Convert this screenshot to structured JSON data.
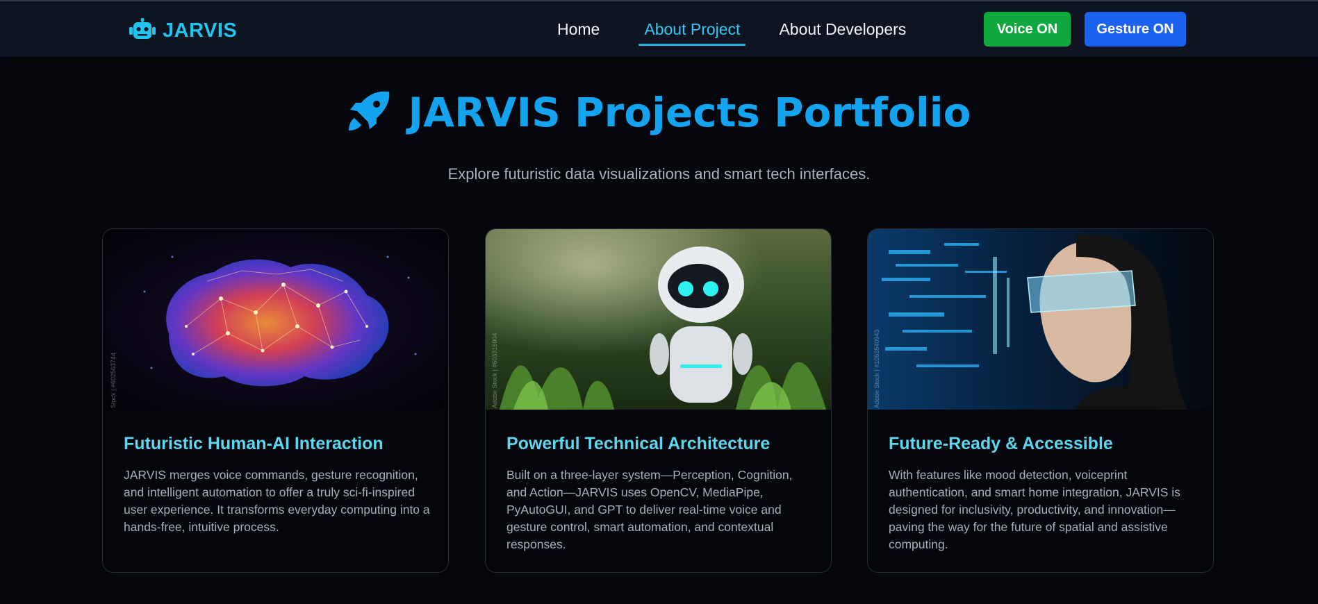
{
  "nav": {
    "brand": "JARVIS",
    "links": [
      "Home",
      "About Project",
      "About Developers"
    ],
    "active_link": "About Project",
    "voice_button": "Voice ON",
    "gesture_button": "Gesture ON"
  },
  "hero": {
    "title": "JARVIS Projects Portfolio",
    "subtitle": "Explore futuristic data visualizations and smart tech interfaces."
  },
  "cards": [
    {
      "title": "Futuristic Human-AI Interaction",
      "text": "JARVIS merges voice commands, gesture recognition, and intelligent automation to offer a truly sci-fi-inspired user experience. It transforms everyday computing into a hands-free, intuitive process.",
      "image": "neural-brain-network",
      "watermark": "Stock | #602563744"
    },
    {
      "title": "Powerful Technical Architecture",
      "text": "Built on a three-layer system—Perception, Cognition, and Action—JARVIS uses OpenCV, MediaPipe, PyAutoGUI, and GPT to deliver real-time voice and gesture control, smart automation, and contextual responses.",
      "image": "robot-in-garden",
      "watermark": "Adobe Stock | #603316904"
    },
    {
      "title": "Future-Ready & Accessible",
      "text": "With features like mood detection, voiceprint authentication, and smart home integration, JARVIS is designed for inclusivity, productivity, and innovation—paving the way for the future of spatial and assistive computing.",
      "image": "woman-with-holographic-visor",
      "watermark": "Adobe Stock | #1053540943"
    }
  ],
  "colors": {
    "accent": "#14a3ee",
    "card_title": "#5fd6ee",
    "voice": "#0fa83f",
    "gesture": "#1b62f0"
  }
}
